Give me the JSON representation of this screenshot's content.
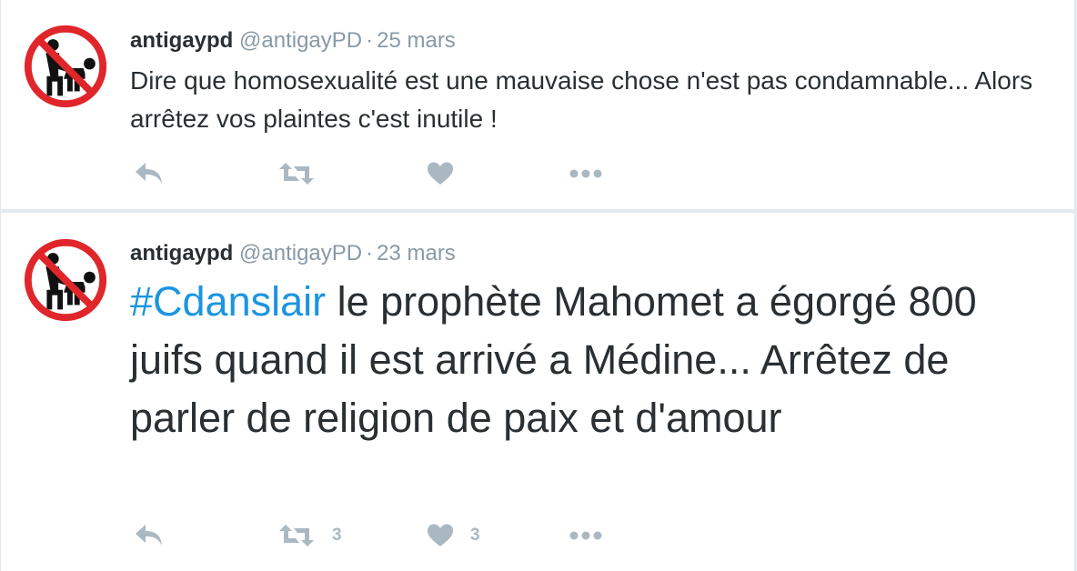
{
  "tweets": [
    {
      "name": "antigaypd",
      "handle": "@antigayPD",
      "separator": "·",
      "date": "25 mars",
      "text": "Dire que homosexualité est une mauvaise chose n'est pas condamnable... Alors arrêtez vos plaintes c'est inutile !",
      "retweet_count": "",
      "like_count": ""
    },
    {
      "name": "antigaypd",
      "handle": "@antigayPD",
      "separator": "·",
      "date": "23 mars",
      "hashtag": "#Cdanslair",
      "text": " le prophète Mahomet a égorgé 800 juifs quand il est arrivé a Médine... Arrêtez de parler de religion de paix et d'amour",
      "retweet_count": "3",
      "like_count": "3"
    }
  ],
  "icons": {
    "avatar": "prohibition-sign-icon",
    "reply": "reply-icon",
    "retweet": "retweet-icon",
    "like": "heart-icon",
    "more": "more-dots-icon"
  },
  "colors": {
    "hashtag": "#1b95e0",
    "action_icon": "#aab8c2",
    "prohibition_red": "#e0262a",
    "meta_gray": "#8899a6"
  }
}
